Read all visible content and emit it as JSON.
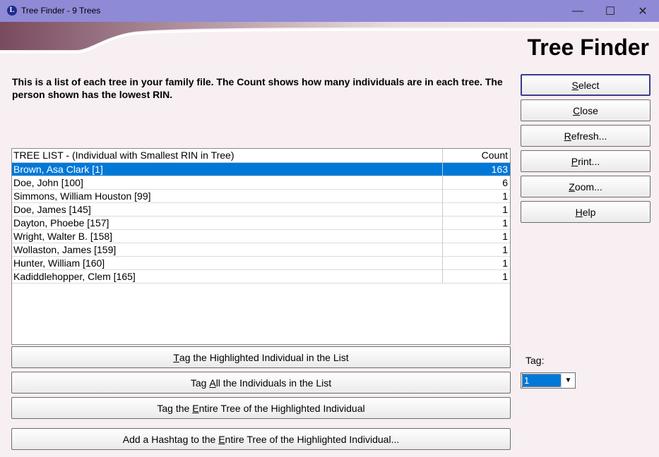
{
  "window": {
    "title": "Tree Finder - 9 Trees",
    "icon_letter": "L"
  },
  "banner": {
    "title": "Tree Finder"
  },
  "description": "This is a list of each tree in your family file.  The Count shows how many individuals are in each tree.  The person shown has the lowest RIN.",
  "side_buttons": {
    "select": {
      "prefix": "",
      "key": "S",
      "rest": "elect"
    },
    "close": {
      "prefix": "",
      "key": "C",
      "rest": "lose"
    },
    "refresh": {
      "prefix": "",
      "key": "R",
      "rest": "efresh..."
    },
    "print": {
      "prefix": "",
      "key": "P",
      "rest": "rint..."
    },
    "zoom": {
      "prefix": "",
      "key": "Z",
      "rest": "oom..."
    },
    "help": {
      "prefix": "",
      "key": "H",
      "rest": "elp"
    }
  },
  "list": {
    "header_name": "TREE LIST - (Individual with Smallest RIN in Tree)",
    "header_count": "Count",
    "rows": [
      {
        "name": "Brown, Asa Clark [1]",
        "count": "163"
      },
      {
        "name": "Doe, John [100]",
        "count": "6"
      },
      {
        "name": "Simmons, William Houston [99]",
        "count": "1"
      },
      {
        "name": "Doe, James [145]",
        "count": "1"
      },
      {
        "name": "Dayton, Phoebe [157]",
        "count": "1"
      },
      {
        "name": "Wright, Walter B. [158]",
        "count": "1"
      },
      {
        "name": "Wollaston, James [159]",
        "count": "1"
      },
      {
        "name": "Hunter, William [160]",
        "count": "1"
      },
      {
        "name": "Kadiddlehopper, Clem [165]",
        "count": "1"
      }
    ]
  },
  "tag_buttons": {
    "highlighted": {
      "prefix": "",
      "key": "T",
      "rest": "ag the Highlighted Individual in the List"
    },
    "all": {
      "prefix": "Tag ",
      "key": "A",
      "rest": "ll the Individuals in the List"
    },
    "entire": {
      "prefix": "Tag the ",
      "key": "E",
      "rest": "ntire Tree of the Highlighted Individual"
    },
    "hashtag": {
      "prefix": "Add a Hashtag to the ",
      "key": "E",
      "rest": "ntire Tree of the Highlighted Individual..."
    }
  },
  "tag": {
    "label": "Tag:",
    "value": "1"
  },
  "colors": {
    "titlebar": "#8e8ad6",
    "selection": "#0078d7",
    "background": "#f7eff1"
  }
}
